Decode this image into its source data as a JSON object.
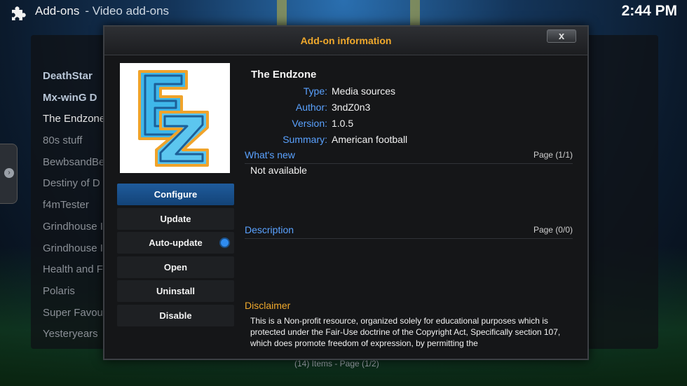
{
  "header": {
    "section": "Add-ons",
    "subsection": "Video add-ons",
    "clock": "2:44 PM"
  },
  "background_list": {
    "items": [
      "DeathStar",
      "Mx-winG D",
      "The Endzone",
      "80s stuff",
      "BewbsandBe",
      "Destiny of D",
      "f4mTester",
      "Grindhouse I",
      "Grindhouse I",
      "Health and F",
      "Polaris",
      "Super Favou",
      "Yesteryears"
    ],
    "footer": "(14) Items - Page (1/2)"
  },
  "dialog": {
    "title": "Add-on information",
    "close_label": "x",
    "addon_name": "The Endzone",
    "fields": {
      "type_label": "Type:",
      "type_value": "Media sources",
      "author_label": "Author:",
      "author_value": "3ndZ0n3",
      "version_label": "Version:",
      "version_value": "1.0.5",
      "summary_label": "Summary:",
      "summary_value": "American football"
    },
    "whats_new": {
      "label": "What's new",
      "page": "Page (1/1)",
      "text": "Not available"
    },
    "description": {
      "label": "Description",
      "page": "Page (0/0)"
    },
    "disclaimer": {
      "label": "Disclaimer",
      "text": "This is a Non-profit resource, organized solely for educational purposes which is protected under the Fair-Use doctrine of the Copyright Act, Specifically section 107, which does promote freedom of expression, by permitting the"
    },
    "buttons": {
      "configure": "Configure",
      "update": "Update",
      "auto_update": "Auto-update",
      "open": "Open",
      "uninstall": "Uninstall",
      "disable": "Disable"
    },
    "auto_update_enabled": true,
    "logo_text": "EZ",
    "colors": {
      "title_orange": "#f0a92c",
      "label_blue": "#5aa2ff",
      "focus_blue": "#1f5b9c"
    }
  }
}
